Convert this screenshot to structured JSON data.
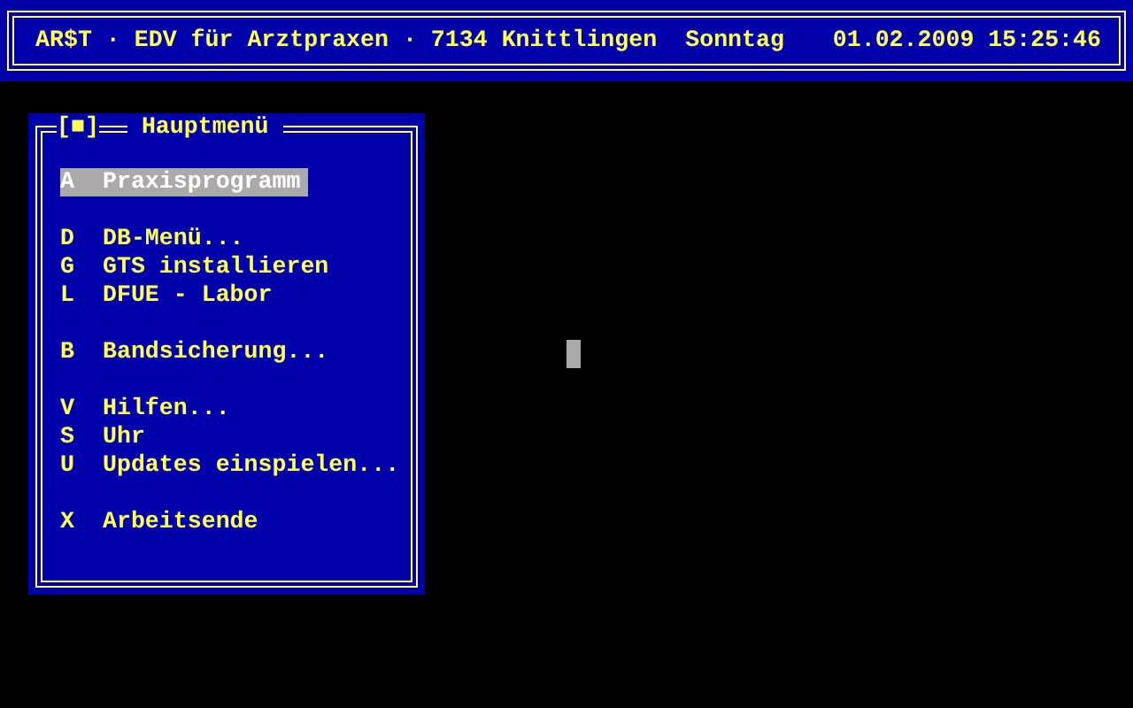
{
  "header": {
    "title": "AR$T · EDV für Arztpraxen · 7134 Knittlingen",
    "weekday": "Sonntag",
    "datetime": "01.02.2009 15:25:46"
  },
  "menu": {
    "close_button": "[■]",
    "title": "Hauptmenü",
    "groups": [
      {
        "items": [
          {
            "key": "A",
            "label": "Praxisprogramm",
            "selected": true
          }
        ]
      },
      {
        "items": [
          {
            "key": "D",
            "label": "DB-Menü...",
            "selected": false
          },
          {
            "key": "G",
            "label": "GTS installieren",
            "selected": false
          },
          {
            "key": "L",
            "label": "DFUE - Labor",
            "selected": false
          }
        ]
      },
      {
        "items": [
          {
            "key": "B",
            "label": "Bandsicherung...",
            "selected": false
          }
        ]
      },
      {
        "items": [
          {
            "key": "V",
            "label": "Hilfen...",
            "selected": false
          },
          {
            "key": "S",
            "label": "Uhr",
            "selected": false
          },
          {
            "key": "U",
            "label": "Updates einspielen...",
            "selected": false
          }
        ]
      },
      {
        "items": [
          {
            "key": "X",
            "label": "Arbeitsende",
            "selected": false
          }
        ]
      }
    ]
  }
}
